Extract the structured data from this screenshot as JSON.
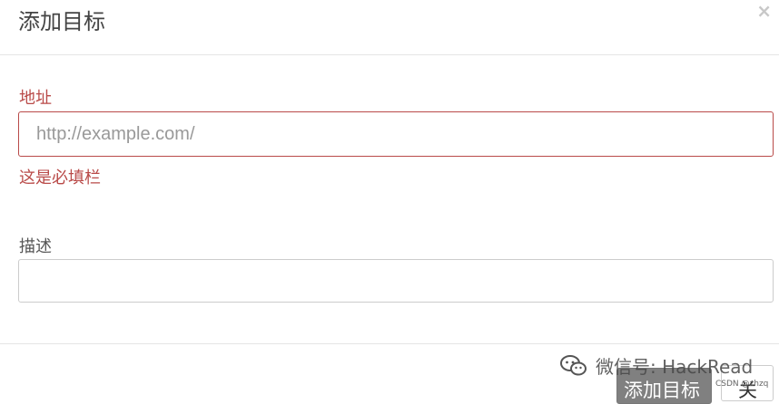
{
  "dialog": {
    "title": "添加目标",
    "close_symbol": "×"
  },
  "form": {
    "url_label": "地址",
    "url_placeholder": "http://example.com/",
    "url_value": "",
    "url_error": "这是必填栏",
    "desc_label": "描述",
    "desc_value": ""
  },
  "footer": {
    "submit_label": "添加目标",
    "close_label": "关"
  },
  "watermark": {
    "text": "微信号: HackRead",
    "icon": "wechat-icon",
    "credit": "CSDN @zhzq"
  },
  "colors": {
    "error": "#b94a48",
    "primary_button": "#808080",
    "border": "#cccccc"
  }
}
